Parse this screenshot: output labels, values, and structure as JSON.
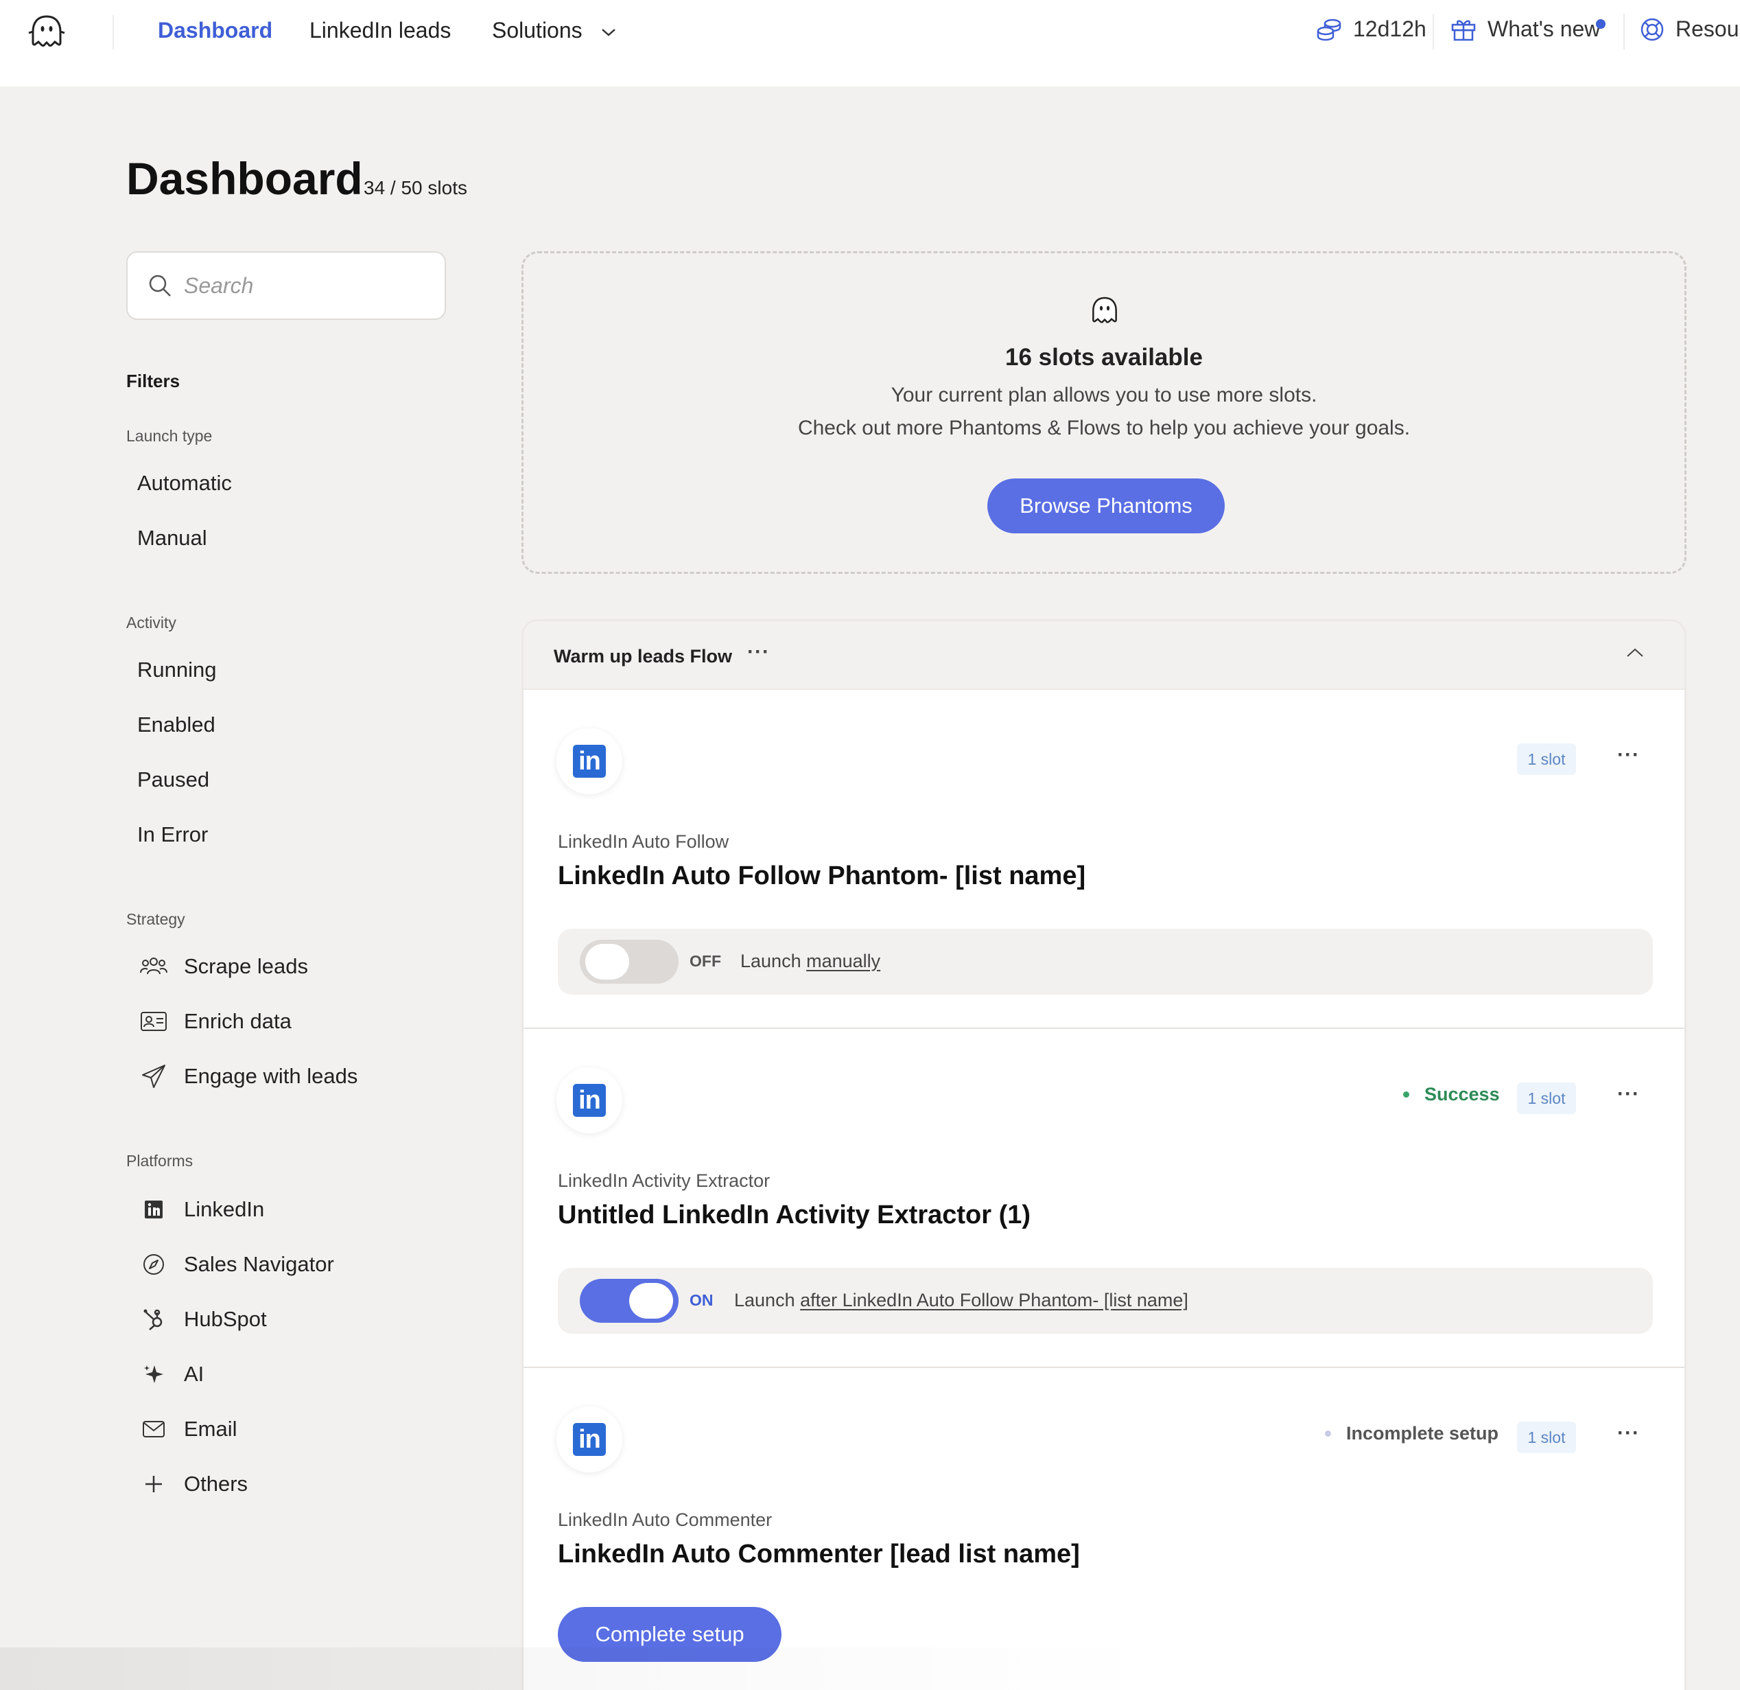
{
  "nav": {
    "dashboard": "Dashboard",
    "linkedin_leads": "LinkedIn leads",
    "solutions": "Solutions",
    "time_left": "12d12h",
    "whats_new": "What's new",
    "resources": "Resour"
  },
  "page": {
    "title": "Dashboard",
    "slots_used": "34 / 50 slots"
  },
  "search": {
    "placeholder": "Search"
  },
  "filters": {
    "title": "Filters",
    "launch_type": {
      "label": "Launch type",
      "items": [
        "Automatic",
        "Manual"
      ]
    },
    "activity": {
      "label": "Activity",
      "items": [
        "Running",
        "Enabled",
        "Paused",
        "In Error"
      ]
    },
    "strategy": {
      "label": "Strategy",
      "items": [
        "Scrape leads",
        "Enrich data",
        "Engage with leads"
      ]
    },
    "platforms": {
      "label": "Platforms",
      "items": [
        "LinkedIn",
        "Sales Navigator",
        "HubSpot",
        "AI",
        "Email",
        "Others"
      ]
    }
  },
  "slots_box": {
    "title": "16 slots available",
    "line1": "Your current plan allows you to use more slots.",
    "line2": "Check out more Phantoms & Flows to help you achieve your goals.",
    "button": "Browse Phantoms"
  },
  "flow": {
    "title": "Warm up leads Flow",
    "dots": "···",
    "phantoms": [
      {
        "kind": "LinkedIn Auto Follow",
        "name": "LinkedIn Auto Follow Phantom- [list name]",
        "slot": "1 slot",
        "status": "",
        "toggle_state": "OFF",
        "launch_prefix": "Launch",
        "launch_link": "manually"
      },
      {
        "kind": "LinkedIn Activity Extractor",
        "name": "Untitled LinkedIn Activity Extractor (1)",
        "slot": "1 slot",
        "status": "Success",
        "toggle_state": "ON",
        "launch_prefix": "Launch",
        "launch_link": "after LinkedIn Auto Follow Phantom- [list name]"
      },
      {
        "kind": "LinkedIn Auto Commenter",
        "name": "LinkedIn Auto Commenter [lead list name]",
        "slot": "1 slot",
        "status": "Incomplete setup",
        "button": "Complete setup"
      }
    ]
  },
  "colors": {
    "accent": "#5a6fe3",
    "nav_active": "#3f5fd6",
    "success": "#2e8b57",
    "linkedin": "#2a6ad4",
    "background": "#f3f1ef"
  },
  "icons": {
    "logo": "ghost-logo-icon",
    "credits": "coins-icon",
    "whats_new": "gift-icon",
    "resources": "lifebuoy-icon"
  }
}
